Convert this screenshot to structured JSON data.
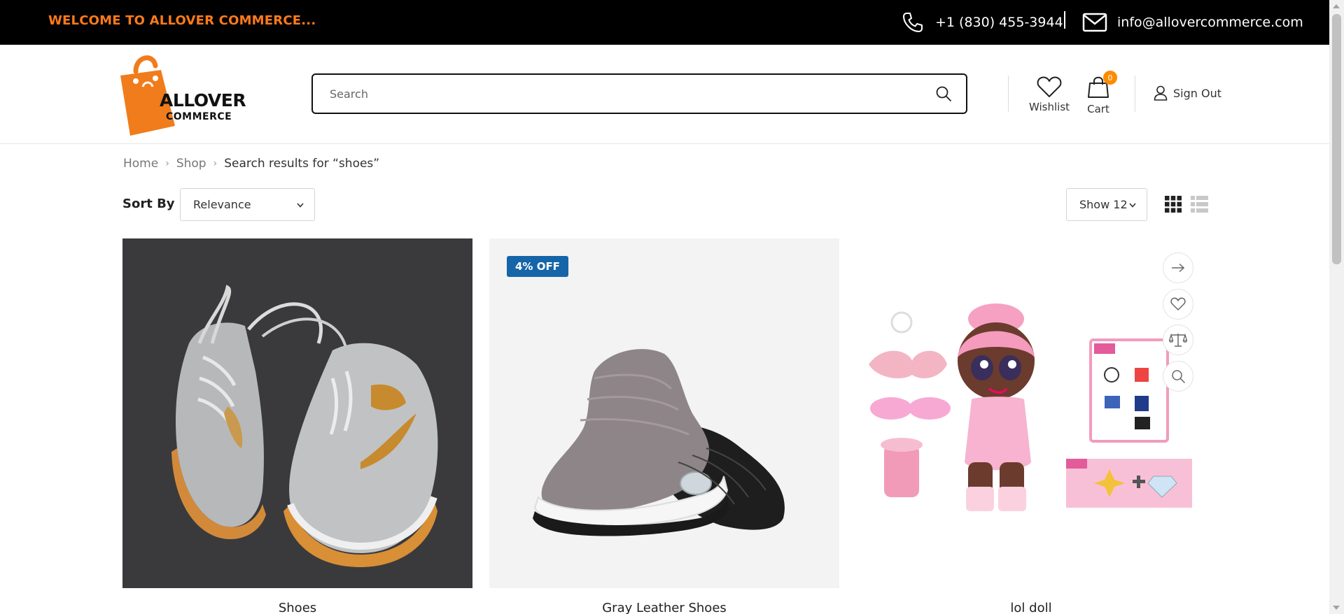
{
  "topbar": {
    "welcome": "WELCOME TO ALLOVER COMMERCE...",
    "phone": "+1 (830) 455-3944",
    "email": "info@allovercommerce.com"
  },
  "logo": {
    "line1": "ALLOVER",
    "line2": "COMMERCE"
  },
  "search": {
    "placeholder": "Search",
    "value": ""
  },
  "header": {
    "wishlist_label": "Wishlist",
    "cart_label": "Cart",
    "cart_count": "0",
    "signout_label": "Sign Out"
  },
  "breadcrumb": {
    "home": "Home",
    "shop": "Shop",
    "current": "Search results for “shoes”"
  },
  "toolbar": {
    "sort_label": "Sort By :",
    "sort_value": "Relevance",
    "show_value": "Show 12"
  },
  "products": [
    {
      "name": "Shoes",
      "badge": ""
    },
    {
      "name": "Gray Leather Shoes",
      "badge": "4% OFF"
    },
    {
      "name": "lol doll",
      "badge": ""
    }
  ],
  "icons": {
    "phone": "phone-icon",
    "email": "mail-icon",
    "search": "search-icon",
    "wishlist": "heart-icon",
    "cart": "shopping-bag-icon",
    "user": "user-icon",
    "grid_view": "grid-view-icon",
    "list_view": "list-view-icon",
    "quick_actions": [
      "arrow-right-icon",
      "heart-icon",
      "compare-icon",
      "zoom-icon"
    ]
  },
  "colors": {
    "accent": "#ff7a1a",
    "badge": "#1565a8",
    "topbar": "#000000"
  }
}
